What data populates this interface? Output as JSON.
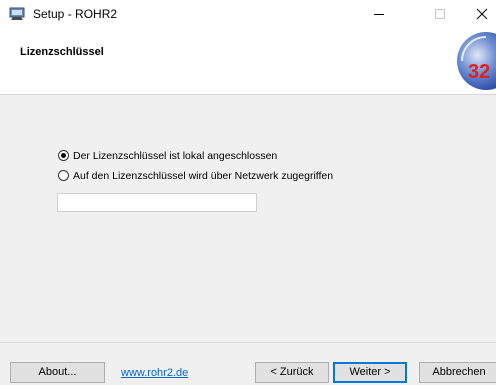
{
  "window": {
    "title": "Setup - ROHR2",
    "minimize_label": "Minimize",
    "maximize_label": "Maximize",
    "close_label": "Close"
  },
  "header": {
    "title": "Lizenzschlüssel",
    "logo_text": "32"
  },
  "options": {
    "local": {
      "label": "Der Lizenzschlüssel ist lokal angeschlossen",
      "selected": true
    },
    "network": {
      "label": "Auf den Lizenzschlüssel wird über Netzwerk zugegriffen",
      "selected": false
    }
  },
  "network_input": {
    "value": "",
    "placeholder": ""
  },
  "footer": {
    "about_label": "About...",
    "link_text": "www.rohr2.de",
    "back_label": "< Zurück",
    "next_label": "Weiter >",
    "cancel_label": "Abbrechen"
  },
  "colors": {
    "accent": "#0078d7",
    "link": "#0066cc",
    "logo_blue": "#1f3fa0",
    "logo_red": "#e02020"
  },
  "icons": {
    "app": "setup-monitor-icon",
    "minimize": "minimize-icon",
    "maximize": "maximize-icon",
    "close": "close-icon"
  }
}
